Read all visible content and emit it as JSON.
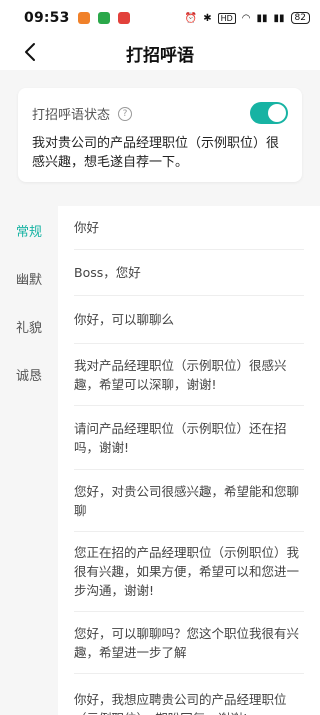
{
  "status_bar": {
    "time": "09:53",
    "battery": "82",
    "network_label": "HD"
  },
  "header": {
    "title": "打招呼语"
  },
  "card": {
    "label": "打招呼语状态",
    "toggle_on": true,
    "text": "我对贵公司的产品经理职位（示例职位）很感兴趣，想毛遂自荐一下。"
  },
  "categories": [
    {
      "label": "常规",
      "active": true
    },
    {
      "label": "幽默",
      "active": false
    },
    {
      "label": "礼貌",
      "active": false
    },
    {
      "label": "诚恳",
      "active": false
    }
  ],
  "greetings": [
    "你好",
    "Boss，您好",
    "你好，可以聊聊么",
    "我对产品经理职位（示例职位）很感兴趣，希望可以深聊，谢谢!",
    "请问产品经理职位（示例职位）还在招吗，谢谢!",
    "您好，对贵公司很感兴趣，希望能和您聊聊",
    "您正在招的产品经理职位（示例职位）我很有兴趣，如果方便，希望可以和您进一步沟通，谢谢!",
    "您好，可以聊聊吗？您这个职位我很有兴趣，希望进一步了解",
    "你好，我想应聘贵公司的产品经理职位（示例职位），期盼回复，谢谢!"
  ],
  "colors": {
    "accent": "#17b3a3"
  }
}
